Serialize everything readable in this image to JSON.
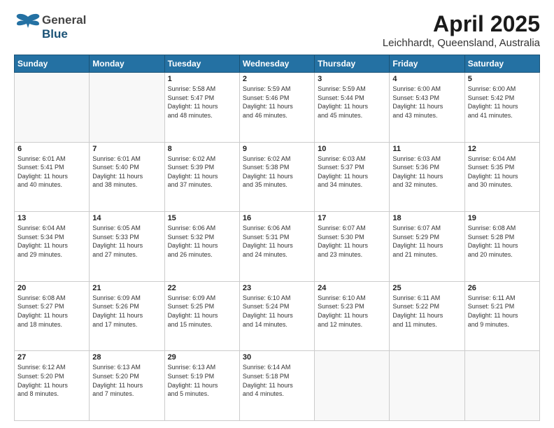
{
  "header": {
    "logo_general": "General",
    "logo_blue": "Blue",
    "title": "April 2025",
    "subtitle": "Leichhardt, Queensland, Australia"
  },
  "calendar": {
    "days_of_week": [
      "Sunday",
      "Monday",
      "Tuesday",
      "Wednesday",
      "Thursday",
      "Friday",
      "Saturday"
    ],
    "weeks": [
      [
        {
          "day": "",
          "info": ""
        },
        {
          "day": "",
          "info": ""
        },
        {
          "day": "1",
          "info": "Sunrise: 5:58 AM\nSunset: 5:47 PM\nDaylight: 11 hours\nand 48 minutes."
        },
        {
          "day": "2",
          "info": "Sunrise: 5:59 AM\nSunset: 5:46 PM\nDaylight: 11 hours\nand 46 minutes."
        },
        {
          "day": "3",
          "info": "Sunrise: 5:59 AM\nSunset: 5:44 PM\nDaylight: 11 hours\nand 45 minutes."
        },
        {
          "day": "4",
          "info": "Sunrise: 6:00 AM\nSunset: 5:43 PM\nDaylight: 11 hours\nand 43 minutes."
        },
        {
          "day": "5",
          "info": "Sunrise: 6:00 AM\nSunset: 5:42 PM\nDaylight: 11 hours\nand 41 minutes."
        }
      ],
      [
        {
          "day": "6",
          "info": "Sunrise: 6:01 AM\nSunset: 5:41 PM\nDaylight: 11 hours\nand 40 minutes."
        },
        {
          "day": "7",
          "info": "Sunrise: 6:01 AM\nSunset: 5:40 PM\nDaylight: 11 hours\nand 38 minutes."
        },
        {
          "day": "8",
          "info": "Sunrise: 6:02 AM\nSunset: 5:39 PM\nDaylight: 11 hours\nand 37 minutes."
        },
        {
          "day": "9",
          "info": "Sunrise: 6:02 AM\nSunset: 5:38 PM\nDaylight: 11 hours\nand 35 minutes."
        },
        {
          "day": "10",
          "info": "Sunrise: 6:03 AM\nSunset: 5:37 PM\nDaylight: 11 hours\nand 34 minutes."
        },
        {
          "day": "11",
          "info": "Sunrise: 6:03 AM\nSunset: 5:36 PM\nDaylight: 11 hours\nand 32 minutes."
        },
        {
          "day": "12",
          "info": "Sunrise: 6:04 AM\nSunset: 5:35 PM\nDaylight: 11 hours\nand 30 minutes."
        }
      ],
      [
        {
          "day": "13",
          "info": "Sunrise: 6:04 AM\nSunset: 5:34 PM\nDaylight: 11 hours\nand 29 minutes."
        },
        {
          "day": "14",
          "info": "Sunrise: 6:05 AM\nSunset: 5:33 PM\nDaylight: 11 hours\nand 27 minutes."
        },
        {
          "day": "15",
          "info": "Sunrise: 6:06 AM\nSunset: 5:32 PM\nDaylight: 11 hours\nand 26 minutes."
        },
        {
          "day": "16",
          "info": "Sunrise: 6:06 AM\nSunset: 5:31 PM\nDaylight: 11 hours\nand 24 minutes."
        },
        {
          "day": "17",
          "info": "Sunrise: 6:07 AM\nSunset: 5:30 PM\nDaylight: 11 hours\nand 23 minutes."
        },
        {
          "day": "18",
          "info": "Sunrise: 6:07 AM\nSunset: 5:29 PM\nDaylight: 11 hours\nand 21 minutes."
        },
        {
          "day": "19",
          "info": "Sunrise: 6:08 AM\nSunset: 5:28 PM\nDaylight: 11 hours\nand 20 minutes."
        }
      ],
      [
        {
          "day": "20",
          "info": "Sunrise: 6:08 AM\nSunset: 5:27 PM\nDaylight: 11 hours\nand 18 minutes."
        },
        {
          "day": "21",
          "info": "Sunrise: 6:09 AM\nSunset: 5:26 PM\nDaylight: 11 hours\nand 17 minutes."
        },
        {
          "day": "22",
          "info": "Sunrise: 6:09 AM\nSunset: 5:25 PM\nDaylight: 11 hours\nand 15 minutes."
        },
        {
          "day": "23",
          "info": "Sunrise: 6:10 AM\nSunset: 5:24 PM\nDaylight: 11 hours\nand 14 minutes."
        },
        {
          "day": "24",
          "info": "Sunrise: 6:10 AM\nSunset: 5:23 PM\nDaylight: 11 hours\nand 12 minutes."
        },
        {
          "day": "25",
          "info": "Sunrise: 6:11 AM\nSunset: 5:22 PM\nDaylight: 11 hours\nand 11 minutes."
        },
        {
          "day": "26",
          "info": "Sunrise: 6:11 AM\nSunset: 5:21 PM\nDaylight: 11 hours\nand 9 minutes."
        }
      ],
      [
        {
          "day": "27",
          "info": "Sunrise: 6:12 AM\nSunset: 5:20 PM\nDaylight: 11 hours\nand 8 minutes."
        },
        {
          "day": "28",
          "info": "Sunrise: 6:13 AM\nSunset: 5:20 PM\nDaylight: 11 hours\nand 7 minutes."
        },
        {
          "day": "29",
          "info": "Sunrise: 6:13 AM\nSunset: 5:19 PM\nDaylight: 11 hours\nand 5 minutes."
        },
        {
          "day": "30",
          "info": "Sunrise: 6:14 AM\nSunset: 5:18 PM\nDaylight: 11 hours\nand 4 minutes."
        },
        {
          "day": "",
          "info": ""
        },
        {
          "day": "",
          "info": ""
        },
        {
          "day": "",
          "info": ""
        }
      ]
    ]
  }
}
